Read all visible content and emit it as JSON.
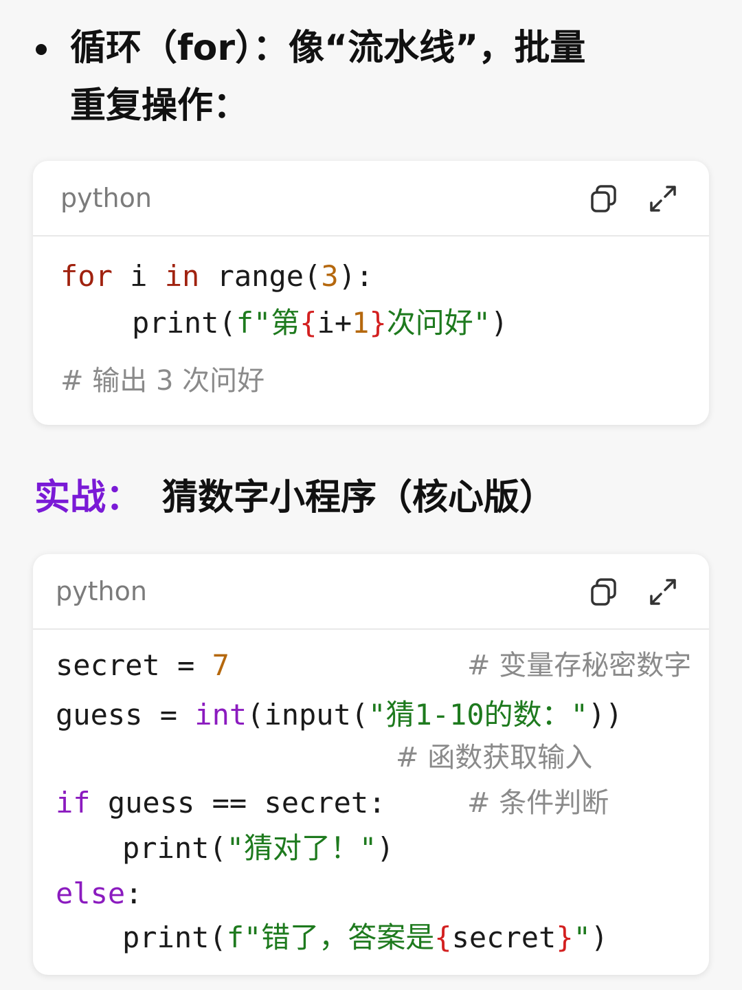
{
  "bullet": {
    "line1": "循环（for）：像“流水线”，批量",
    "line2": "重复操作："
  },
  "section": {
    "accent": "实战：",
    "title": "猜数字小程序（核心版）"
  },
  "card1": {
    "lang": "python",
    "copy_icon": "copy-icon",
    "expand_icon": "expand-icon",
    "lines": {
      "l1": {
        "kw_for": "for",
        "t1": " i ",
        "kw_in": "in",
        "t2": " range(",
        "n3": "3",
        "t3": "):"
      },
      "l2": {
        "t1": "print(",
        "s1": "f\"第",
        "b1": "{",
        "v": "i+",
        "n1": "1",
        "b2": "}",
        "s2": "次问好\"",
        "t2": ")"
      },
      "comment": "# 输出 3 次问好"
    }
  },
  "card2": {
    "lang": "python",
    "copy_icon": "copy-icon",
    "expand_icon": "expand-icon",
    "lines": {
      "l1": {
        "t1": "secret = ",
        "n1": "7",
        "comment": "# 变量存秘密数字"
      },
      "l2": {
        "t1": "guess = ",
        "kw": "int",
        "t2": "(input(",
        "s1": "\"猜1-10的数：\"",
        "t3": "))"
      },
      "l2c": "# 函数获取输入",
      "l3": {
        "kw": "if",
        "t1": " guess == secret:",
        "comment": "# 条件判断"
      },
      "l4": {
        "t1": "print(",
        "s1": "\"猜对了！\"",
        "t2": ")"
      },
      "l5": {
        "kw": "else",
        "t1": ":"
      },
      "l6": {
        "t1": "print(",
        "s1": "f\"错了，答案是",
        "b1": "{",
        "v": "secret",
        "b2": "}",
        "s2": "\"",
        "t2": ")"
      }
    }
  }
}
